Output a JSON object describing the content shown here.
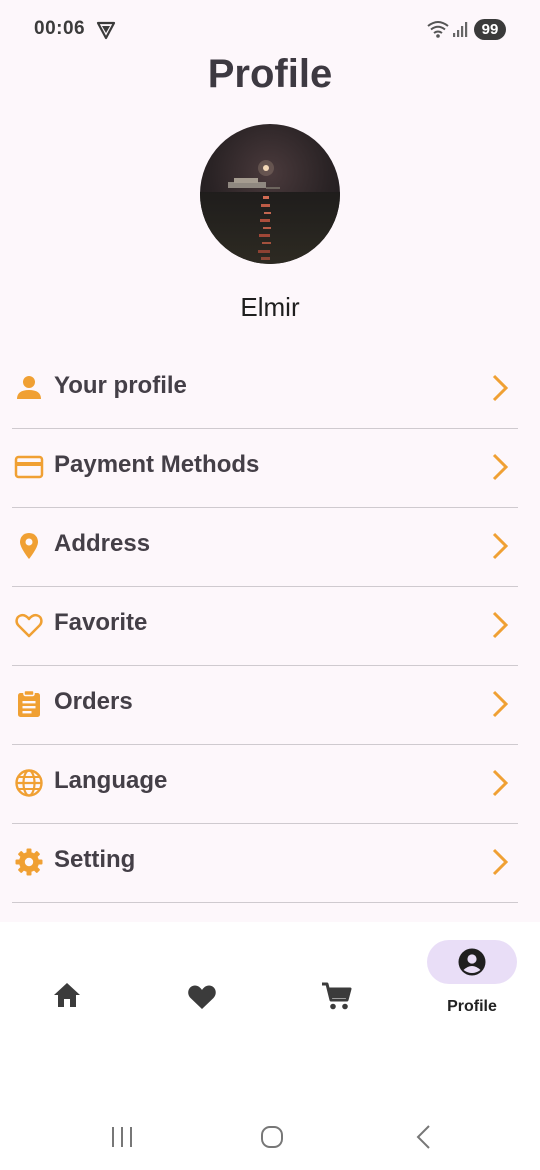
{
  "status_bar": {
    "time": "00:06",
    "battery": "99",
    "icons": [
      "vpn-shield-icon",
      "wifi-icon",
      "signal-icon"
    ]
  },
  "header": {
    "title": "Profile"
  },
  "user": {
    "name": "Elmir"
  },
  "menu": {
    "accent_color": "#f0a033",
    "items": [
      {
        "label": "Your profile",
        "icon": "person-icon"
      },
      {
        "label": "Payment Methods",
        "icon": "credit-card-icon"
      },
      {
        "label": "Address",
        "icon": "location-pin-icon"
      },
      {
        "label": "Favorite",
        "icon": "heart-outline-icon"
      },
      {
        "label": "Orders",
        "icon": "clipboard-icon"
      },
      {
        "label": "Language",
        "icon": "globe-icon"
      },
      {
        "label": "Setting",
        "icon": "gear-icon"
      }
    ]
  },
  "bottom_nav": {
    "items": [
      {
        "icon": "home-icon"
      },
      {
        "icon": "heart-icon"
      },
      {
        "icon": "cart-icon"
      },
      {
        "icon": "account-circle-icon",
        "label": "Profile",
        "active": true
      }
    ],
    "active_pill_color": "#e9def7"
  },
  "system_nav": {
    "icons": [
      "recents-icon",
      "home-circle-icon",
      "back-icon"
    ]
  }
}
